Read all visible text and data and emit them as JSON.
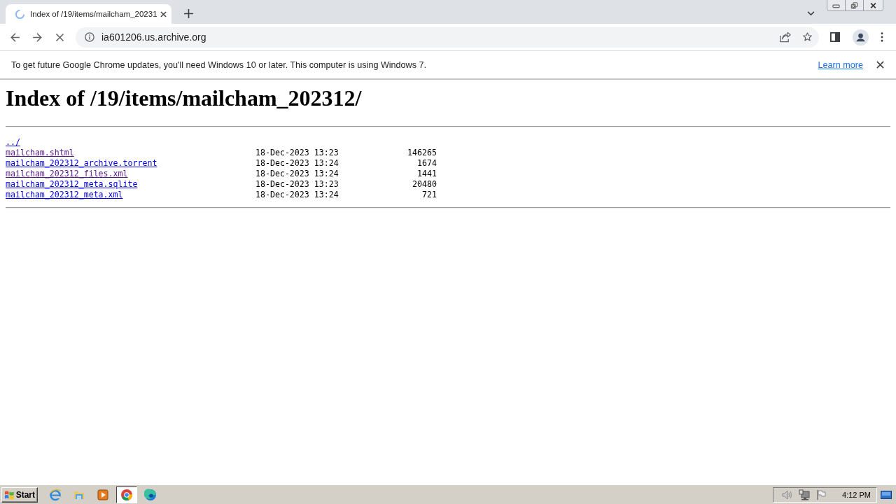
{
  "browser": {
    "tab": {
      "title": "Index of /19/items/mailcham_20231",
      "loading": true
    },
    "address": "ia601206.us.archive.org"
  },
  "infobar": {
    "message": "To get future Google Chrome updates, you'll need Windows 10 or later. This computer is using Windows 7.",
    "link": "Learn more"
  },
  "page": {
    "heading": "Index of /19/items/mailcham_202312/",
    "parent_link": {
      "label": "../",
      "visited": false
    },
    "rows": [
      {
        "name": "mailcham.shtml",
        "visited": true,
        "date": "18-Dec-2023 13:23",
        "size": "146265"
      },
      {
        "name": "mailcham_202312_archive.torrent",
        "visited": false,
        "date": "18-Dec-2023 13:24",
        "size": "1674"
      },
      {
        "name": "mailcham_202312_files.xml",
        "visited": true,
        "date": "18-Dec-2023 13:24",
        "size": "1441"
      },
      {
        "name": "mailcham_202312_meta.sqlite",
        "visited": false,
        "date": "18-Dec-2023 13:23",
        "size": "20480"
      },
      {
        "name": "mailcham_202312_meta.xml",
        "visited": false,
        "date": "18-Dec-2023 13:24",
        "size": "721"
      }
    ]
  },
  "taskbar": {
    "start": "Start",
    "apps": [
      {
        "kind": "e-logo",
        "selected": false
      },
      {
        "kind": "folder",
        "selected": false
      },
      {
        "kind": "play",
        "selected": false
      },
      {
        "kind": "ring-logo",
        "selected": true
      },
      {
        "kind": "swirl-logo",
        "selected": false
      }
    ],
    "clock": "4:12 PM"
  }
}
